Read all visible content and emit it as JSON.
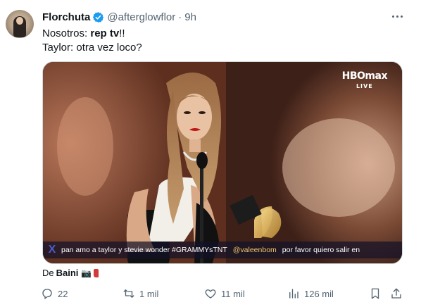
{
  "author": {
    "display_name": "Florchuta",
    "handle": "@afterglowflor",
    "separator": "·",
    "time": "9h"
  },
  "tweet": {
    "line1_prefix": "Nosotros: ",
    "line1_bold": "rep tv",
    "line1_suffix": "!!",
    "line2": "Taylor: otra vez loco?"
  },
  "media": {
    "brand": "HBOmax",
    "live_label": "LIVE",
    "ticker": {
      "x_logo": "X",
      "segment1": "pan amo a taylor y stevie wonder #GRAMMYsTNT",
      "mention": "@valeenbom",
      "segment2": "por favor quiero salir en"
    }
  },
  "attribution": {
    "prefix": "De",
    "source": "Baini",
    "emoji": "📷"
  },
  "actions": {
    "replies": "22",
    "reposts": "1 mil",
    "likes": "11 mil",
    "views": "126 mil"
  },
  "icons": {
    "verified": "verified-badge-icon",
    "more": "more-icon",
    "reply": "reply-icon",
    "repost": "repost-icon",
    "like": "heart-icon",
    "views": "views-icon",
    "bookmark": "bookmark-icon",
    "share": "share-icon"
  },
  "colors": {
    "verified_blue": "#1d9bf0",
    "secondary_text": "#536471",
    "primary_text": "#0f1419",
    "ticker_mention": "#f1c76b"
  }
}
